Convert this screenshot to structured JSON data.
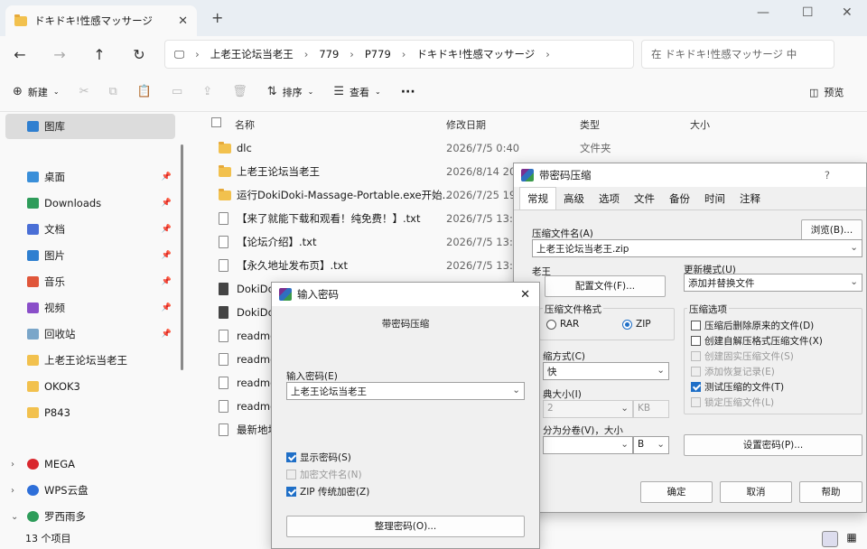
{
  "explorer": {
    "tab_title": "ドキドキ!性感マッサージ",
    "address": [
      "上老王论坛当老王",
      "779",
      "P779",
      "ドキドキ!性感マッサージ"
    ],
    "search_placeholder": "在 ドキドキ!性感マッサージ 中",
    "toolbar": {
      "new": "新建",
      "sort": "排序",
      "view": "查看",
      "more": "···",
      "preview": "预览"
    },
    "sidebar": {
      "gallery": "图库",
      "quick": [
        {
          "label": "桌面",
          "color": "#3a8fd9"
        },
        {
          "label": "Downloads",
          "color": "#2e9c5a"
        },
        {
          "label": "文档",
          "color": "#4a6fd6"
        },
        {
          "label": "图片",
          "color": "#2f7fd0"
        },
        {
          "label": "音乐",
          "color": "#e0563a"
        },
        {
          "label": "视频",
          "color": "#8a4fc9"
        },
        {
          "label": "回收站",
          "color": "#7aa6c9"
        },
        {
          "label": "上老王论坛当老王",
          "color": "#f2c14e"
        },
        {
          "label": "OKOK3",
          "color": "#f2c14e"
        },
        {
          "label": "P843",
          "color": "#f2c14e"
        }
      ],
      "drives": [
        {
          "label": "MEGA",
          "color": "#d9272e"
        },
        {
          "label": "WPS云盘",
          "color": "#2e6fd9"
        },
        {
          "label": "罗西雨多",
          "color": "#2e9c5a"
        }
      ]
    },
    "columns": {
      "name": "名称",
      "date": "修改日期",
      "type": "类型",
      "size": "大小"
    },
    "files": [
      {
        "name": "dlc",
        "date": "2026/7/5 0:40",
        "type": "文件夹",
        "kind": "folder"
      },
      {
        "name": "上老王论坛当老王",
        "date": "2026/8/14 20",
        "type": "",
        "kind": "folder"
      },
      {
        "name": "运行DokiDoki-Massage-Portable.exe开始...",
        "date": "2026/7/25 19",
        "type": "",
        "kind": "folder"
      },
      {
        "name": "【来了就能下载和观看！纯免费！】.txt",
        "date": "2026/7/5 13:1",
        "type": "",
        "kind": "txt"
      },
      {
        "name": "【论坛介绍】.txt",
        "date": "2026/7/5 13:1",
        "type": "",
        "kind": "txt"
      },
      {
        "name": "【永久地址发布页】.txt",
        "date": "2026/7/5 13:1",
        "type": "",
        "kind": "txt"
      },
      {
        "name": "DokiDo",
        "date": "",
        "type": "",
        "kind": "app"
      },
      {
        "name": "DokiDo",
        "date": "",
        "type": "",
        "kind": "app"
      },
      {
        "name": "readme",
        "date": "",
        "type": "",
        "kind": "txt"
      },
      {
        "name": "readme",
        "date": "",
        "type": "",
        "kind": "txt"
      },
      {
        "name": "readme",
        "date": "",
        "type": "",
        "kind": "txt"
      },
      {
        "name": "readme",
        "date": "",
        "type": "",
        "kind": "txt"
      },
      {
        "name": "最新地址",
        "date": "",
        "type": "",
        "kind": "txt"
      }
    ],
    "status": "13 个项目"
  },
  "archive": {
    "title": "带密码压缩",
    "help": "?",
    "tabs": [
      "常规",
      "高级",
      "选项",
      "文件",
      "备份",
      "时间",
      "注释"
    ],
    "archive_name_label": "压缩文件名(A)",
    "browse": "浏览(B)...",
    "archive_name": "上老王论坛当老王.zip",
    "profile_label": "老王",
    "profile_btn": "配置文件(F)...",
    "update_label": "更新模式(U)",
    "update_value": "添加并替换文件",
    "format_label": "压缩文件格式",
    "rar": "RAR",
    "zip": "ZIP",
    "method_label": "缩方式(C)",
    "method_value": "快",
    "dict_label": "典大小(I)",
    "dict_value": "2",
    "dict_unit": "KB",
    "split_label": "分为分卷(V)，大小",
    "split_unit": "B",
    "options_label": "压缩选项",
    "options": [
      {
        "label": "压缩后删除原来的文件(D)",
        "state": "off"
      },
      {
        "label": "创建自解压格式压缩文件(X)",
        "state": "off"
      },
      {
        "label": "创建固实压缩文件(S)",
        "state": "dis"
      },
      {
        "label": "添加恢复记录(E)",
        "state": "dis"
      },
      {
        "label": "测试压缩的文件(T)",
        "state": "on"
      },
      {
        "label": "锁定压缩文件(L)",
        "state": "dis"
      }
    ],
    "set_password": "设置密码(P)...",
    "ok": "确定",
    "cancel": "取消",
    "help_btn": "帮助"
  },
  "password": {
    "title": "输入密码",
    "subtitle": "带密码压缩",
    "enter_label": "输入密码(E)",
    "password_value": "上老王论坛当老王",
    "show": "显示密码(S)",
    "encrypt_names": "加密文件名(N)",
    "zip_legacy": "ZIP 传统加密(Z)",
    "organize": "整理密码(O)..."
  }
}
